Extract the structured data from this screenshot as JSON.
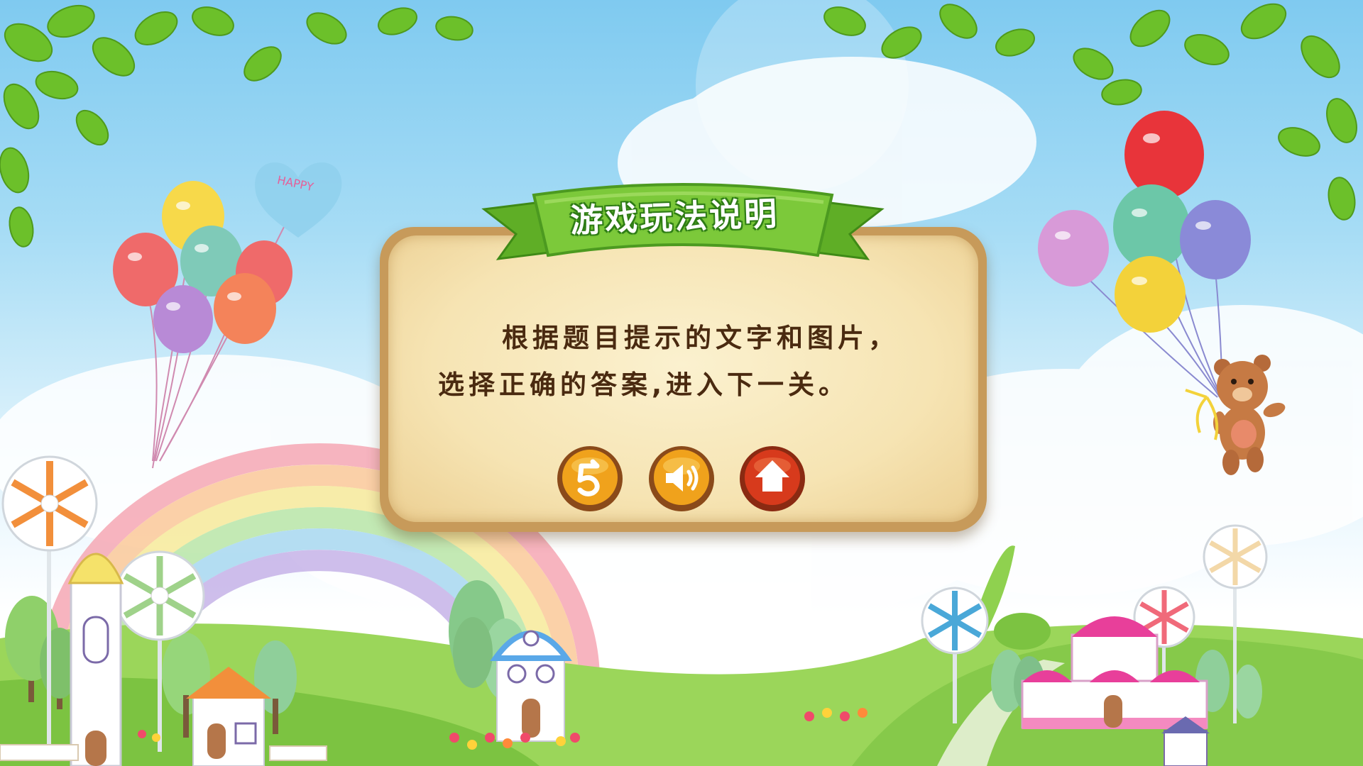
{
  "dialog": {
    "title": "游戏玩法说明",
    "instructions": "根据题目提示的文字和图片，\n选择正确的答案,进入下一关。"
  },
  "buttons": [
    {
      "name": "replay-button",
      "icon": "replay-icon",
      "color": "#f0a21c"
    },
    {
      "name": "sound-button",
      "icon": "speaker-icon",
      "color": "#f0a21c"
    },
    {
      "name": "home-button",
      "icon": "home-icon",
      "color": "#d73a1c"
    }
  ],
  "decor": {
    "balloon_heart_text": "HAPPY"
  },
  "colors": {
    "sky": "#7fcaf0",
    "grass": "#8fd14f",
    "panel_parchment": "#f6e4b3",
    "panel_border": "#c79a5a",
    "ribbon": "#7cc93a",
    "text": "#4a2a10"
  }
}
